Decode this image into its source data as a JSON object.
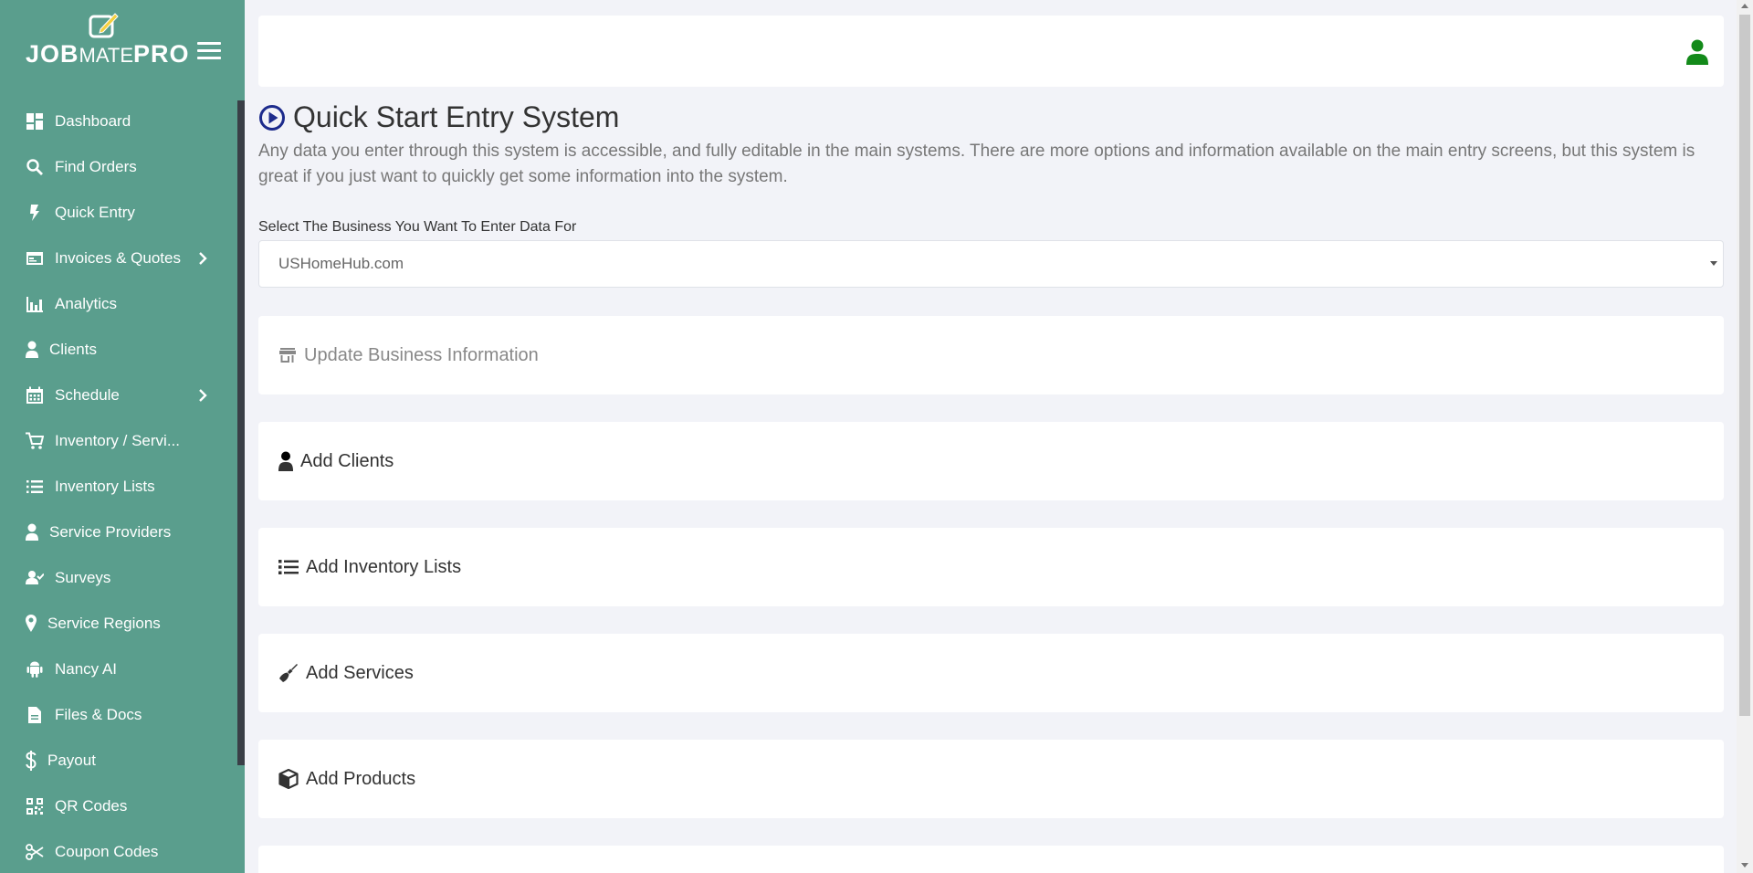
{
  "app": {
    "logo_job": "JOB",
    "logo_mate": "MATE",
    "logo_pro": "PRO"
  },
  "colors": {
    "sidebar_bg": "#5a9e8d",
    "accent_user": "#138a1a",
    "title_icon": "#1d2b8c"
  },
  "sidebar": {
    "items": [
      {
        "label": "Dashboard",
        "icon": "dashboard-icon"
      },
      {
        "label": "Find Orders",
        "icon": "search-icon"
      },
      {
        "label": "Quick Entry",
        "icon": "bolt-icon"
      },
      {
        "label": "Invoices & Quotes",
        "icon": "invoice-icon"
      },
      {
        "label": "Analytics",
        "icon": "bar-chart-icon"
      },
      {
        "label": "Clients",
        "icon": "user-icon"
      },
      {
        "label": "Schedule",
        "icon": "calendar-icon"
      },
      {
        "label": "Inventory / Servi...",
        "icon": "cart-icon"
      },
      {
        "label": "Inventory Lists",
        "icon": "list-icon"
      },
      {
        "label": "Service Providers",
        "icon": "user-icon"
      },
      {
        "label": "Surveys",
        "icon": "survey-icon"
      },
      {
        "label": "Service Regions",
        "icon": "map-pin-icon"
      },
      {
        "label": "Nancy AI",
        "icon": "android-icon"
      },
      {
        "label": "Files & Docs",
        "icon": "file-icon"
      },
      {
        "label": "Payout",
        "icon": "dollar-icon"
      },
      {
        "label": "QR Codes",
        "icon": "qr-icon"
      },
      {
        "label": "Coupon Codes",
        "icon": "scissors-icon"
      }
    ]
  },
  "main": {
    "title": "Quick Start Entry System",
    "description": "Any data you enter through this system is accessible, and fully editable in the main systems. There are more options and information available on the main entry screens, but this system is great if you just want to quickly get some information into the system.",
    "select_label": "Select The Business You Want To Enter Data For",
    "select_value": "USHomeHub.com",
    "cards": [
      {
        "label": "Update Business Information",
        "icon": "store-icon"
      },
      {
        "label": "Add Clients",
        "icon": "user-icon"
      },
      {
        "label": "Add Inventory Lists",
        "icon": "list-icon"
      },
      {
        "label": "Add Services",
        "icon": "broom-icon"
      },
      {
        "label": "Add Products",
        "icon": "box-icon"
      }
    ]
  }
}
